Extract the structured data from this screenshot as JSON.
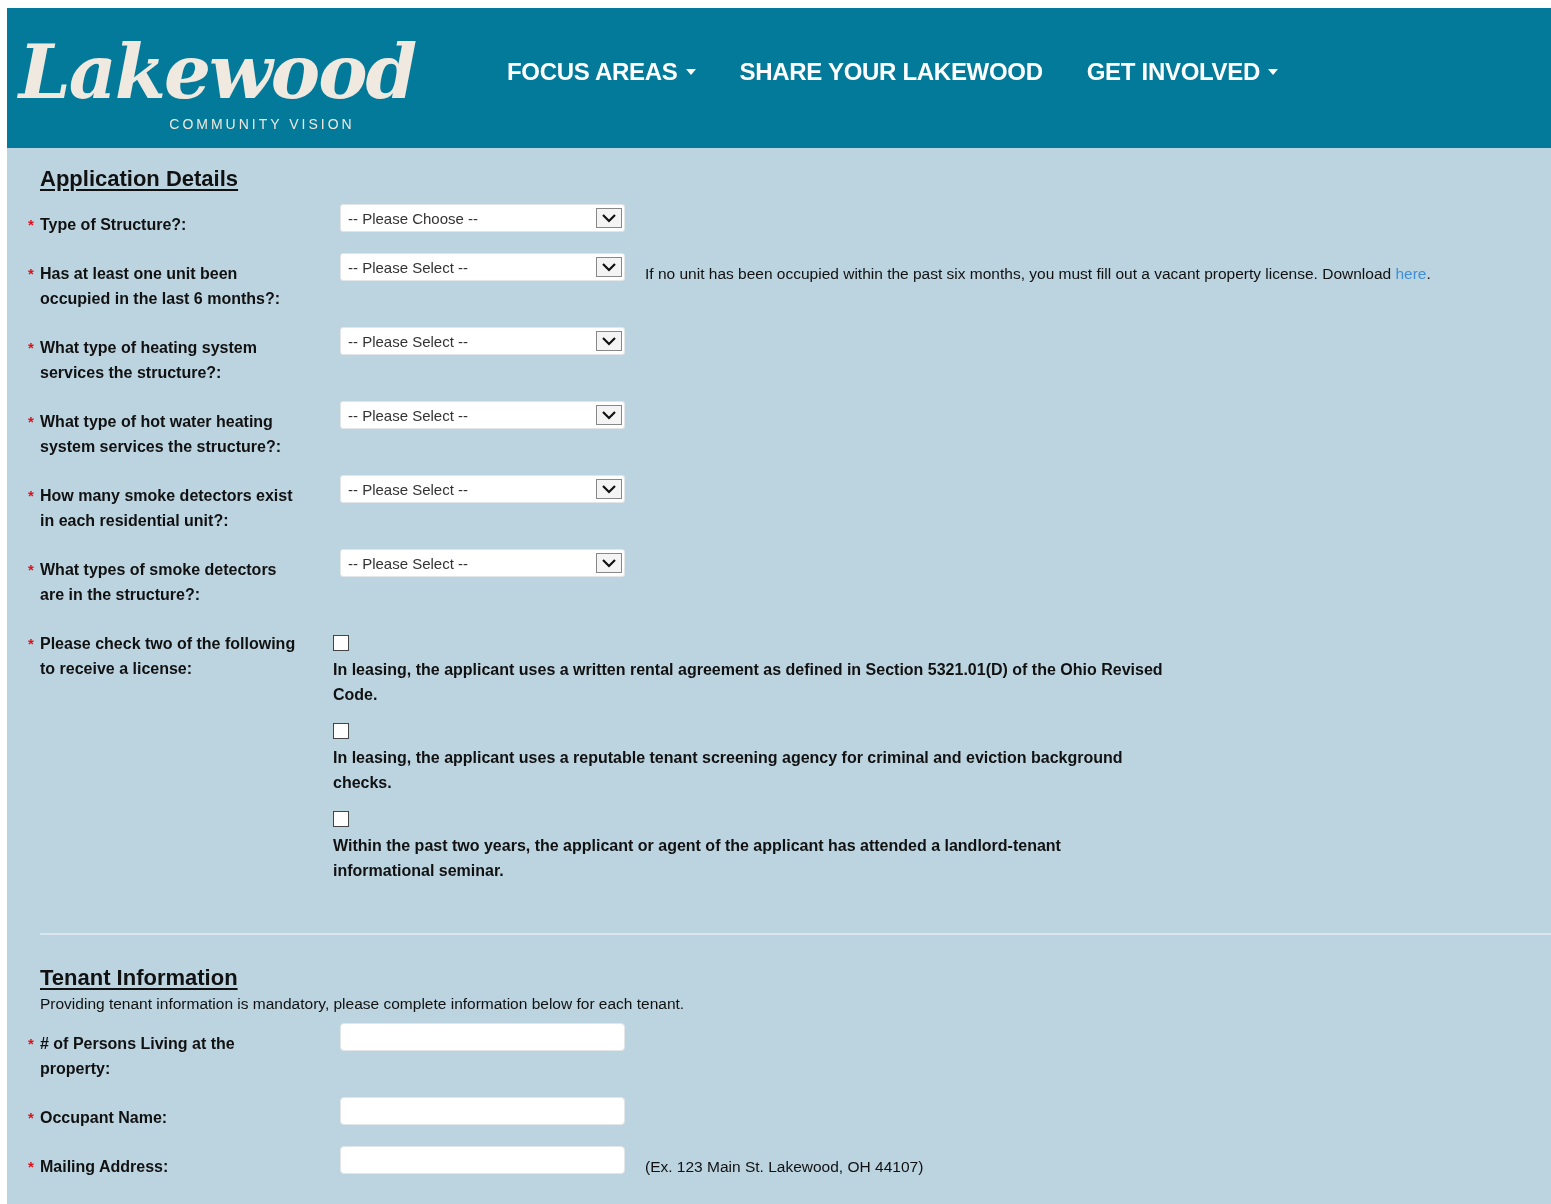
{
  "header": {
    "logo": "Lakewood",
    "tagline": "COMMUNITY VISION",
    "nav": [
      {
        "label": "FOCUS AREAS",
        "dropdown": true
      },
      {
        "label": "SHARE YOUR LAKEWOOD",
        "dropdown": false
      },
      {
        "label": "GET INVOLVED",
        "dropdown": true
      }
    ]
  },
  "sections": [
    {
      "title": "Application Details",
      "fields": [
        {
          "kind": "select",
          "required_mark": "*",
          "label": "Type of Structure?:",
          "value": "-- Please Choose --"
        },
        {
          "kind": "select",
          "required_mark": "*",
          "label": "Has at least one unit been occupied in the last 6 months?:",
          "value": "-- Please Select --",
          "note": "If no unit has been occupied within the past six months, you must fill out a vacant property license. Download ",
          "note_link": "here",
          "note_end": "."
        },
        {
          "kind": "select",
          "required_mark": "*",
          "label": "What type of heating system services the structure?:",
          "value": "-- Please Select --"
        },
        {
          "kind": "select",
          "required_mark": "*",
          "label": "What type of hot water heating system services the structure?:",
          "value": "-- Please Select --"
        },
        {
          "kind": "select",
          "required_mark": "*",
          "label": "How many smoke detectors exist in each residential unit?:",
          "value": "-- Please Select --"
        },
        {
          "kind": "select",
          "required_mark": "*",
          "label": "What types of smoke detectors are in the structure?:",
          "value": "-- Please Select --"
        },
        {
          "kind": "checkboxes",
          "required_mark": "*",
          "label": "Please check two of the following to receive a license:",
          "options": [
            {
              "text": "In leasing, the applicant uses a written rental agreement as defined in Section 5321.01(D) of the Ohio Revised Code.",
              "checked": false
            },
            {
              "text": "In leasing, the applicant uses a reputable tenant screening agency for criminal and eviction background checks.",
              "checked": false
            },
            {
              "text": "Within the past two years, the applicant or agent of the applicant has attended a landlord-tenant informational seminar.",
              "checked": false
            }
          ]
        }
      ]
    },
    {
      "title": "Tenant Information",
      "description": "Providing tenant information is mandatory, please complete information below for each tenant.",
      "fields": [
        {
          "kind": "text",
          "required_mark": "*",
          "label": "# of Persons Living at the property:"
        },
        {
          "kind": "text",
          "required_mark": "*",
          "label": "Occupant Name:"
        },
        {
          "kind": "text",
          "required_mark": "*",
          "label": "Mailing Address:",
          "hint": "(Ex. 123 Main St. Lakewood, OH 44107)"
        }
      ]
    }
  ]
}
